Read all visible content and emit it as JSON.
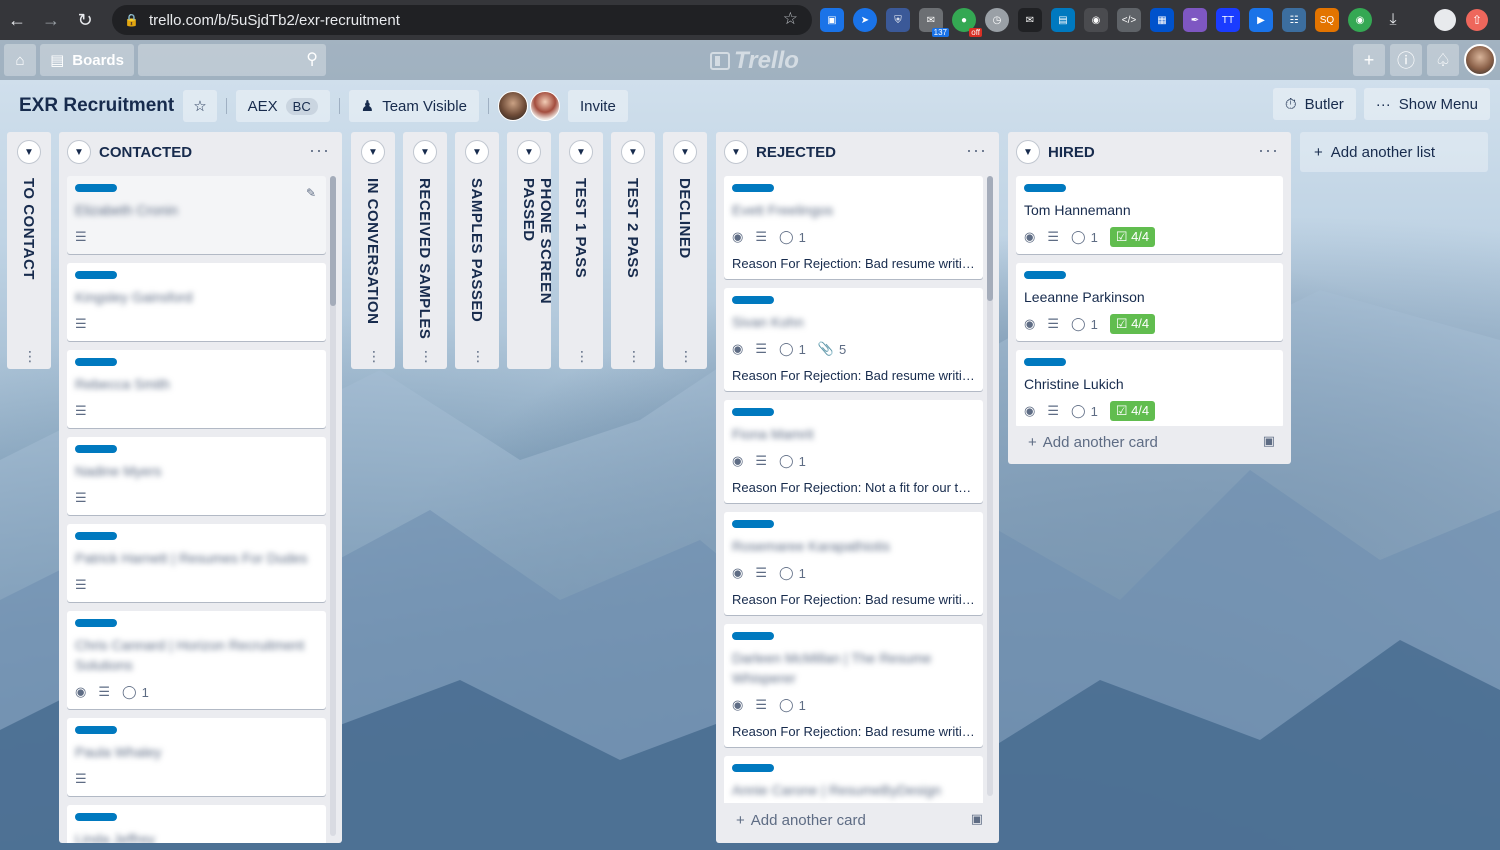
{
  "browser": {
    "url": "trello.com/b/5uSjdTb2/exr-recruitment",
    "ext_badge_count": "137",
    "ext_badge_off": "off"
  },
  "header": {
    "boards_label": "Boards",
    "logo_text": "Trello"
  },
  "board": {
    "title": "EXR Recruitment",
    "team_name": "AEX",
    "team_badge": "BC",
    "visibility": "Team Visible",
    "invite_label": "Invite",
    "butler_label": "Butler",
    "menu_label": "Show Menu"
  },
  "collapsed_lists": [
    {
      "name": "TO CONTACT"
    },
    {
      "name": "IN CONVERSATION"
    },
    {
      "name": "RECEIVED SAMPLES"
    },
    {
      "name": "SAMPLES PASSED"
    },
    {
      "name": "PHONE SCREEN PASSED"
    },
    {
      "name": "TEST 1 PASS"
    },
    {
      "name": "TEST 2 PASS"
    },
    {
      "name": "DECLINED"
    }
  ],
  "contacted": {
    "name": "CONTACTED",
    "cards": [
      {
        "title": "Elizabeth Cronin"
      },
      {
        "title": "Kingsley Gainsford"
      },
      {
        "title": "Rebecca Smith"
      },
      {
        "title": "Nadine Myers"
      },
      {
        "title": "Patrick Harnett | Resumes For Dudes"
      },
      {
        "title": "Chris Cannard | Horizon Recruitment Solutions",
        "comments": "1"
      },
      {
        "title": "Paula Whaley"
      },
      {
        "title": "Linda Jeffrey"
      }
    ]
  },
  "rejected": {
    "name": "REJECTED",
    "cards": [
      {
        "title": "Evett Freelingos",
        "comments": "1",
        "reason": "Reason For Rejection: Bad resume writing"
      },
      {
        "title": "Sivan Kohn",
        "comments": "1",
        "attachments": "5",
        "reason": "Reason For Rejection: Bad resume writing"
      },
      {
        "title": "Fiona Mamrit",
        "comments": "1",
        "reason": "Reason For Rejection: Not a fit for our team"
      },
      {
        "title": "Rosemaree Karapathiotis",
        "comments": "1",
        "reason": "Reason For Rejection: Bad resume writing"
      },
      {
        "title": "Darleen McMillan | The Resume Whisperer",
        "comments": "1",
        "reason": "Reason For Rejection: Bad resume writing"
      },
      {
        "title": "Annie Carone | ResumeByDesign"
      }
    ],
    "add_card": "Add another card"
  },
  "hired": {
    "name": "HIRED",
    "cards": [
      {
        "title": "Tom Hannemann",
        "comments": "1",
        "checklist": "4/4"
      },
      {
        "title": "Leeanne Parkinson",
        "comments": "1",
        "checklist": "4/4"
      },
      {
        "title": "Christine Lukich",
        "comments": "1",
        "checklist": "4/4"
      }
    ],
    "add_card": "Add another card"
  },
  "add_list_label": "Add another list",
  "colors": {
    "label_blue": "#0079bf",
    "checklist_green": "#61bd4f",
    "list_bg": "#ebecf0"
  }
}
